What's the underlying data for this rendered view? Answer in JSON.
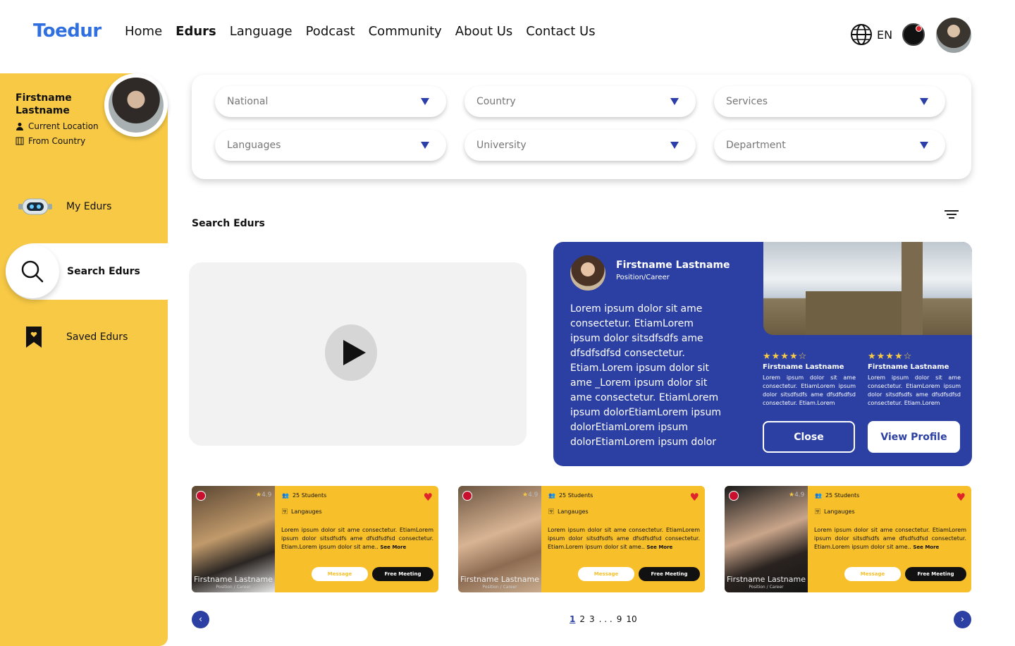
{
  "header": {
    "logo": "Toedur",
    "nav": [
      "Home",
      "Edurs",
      "Language",
      "Podcast",
      "Community",
      "About Us",
      "Contact Us"
    ],
    "active_nav": "Edurs",
    "language": "EN"
  },
  "sidebar": {
    "name": "Firstname Lastname",
    "location": "Current Location",
    "from": "From Country",
    "items": [
      {
        "label": "My Edurs",
        "icon": "robot-icon"
      },
      {
        "label": "Search Edurs",
        "icon": "search-icon",
        "active": true
      },
      {
        "label": "Saved Edurs",
        "icon": "bookmark-icon"
      }
    ]
  },
  "filters": [
    {
      "placeholder": "National"
    },
    {
      "placeholder": "Country"
    },
    {
      "placeholder": "Services"
    },
    {
      "placeholder": "Languages"
    },
    {
      "placeholder": "University"
    },
    {
      "placeholder": "Department"
    }
  ],
  "section_title": "Search Edurs",
  "profile_card": {
    "name": "Firstname Lastname",
    "position": "Position/Career",
    "description": "Lorem ipsum dolor sit ame consectetur. EtiamLorem ipsum dolor sitsdfsdfs ame dfsdfsdfsd consectetur. Etiam.Lorem ipsum dolor sit ame _Lorem ipsum dolor sit ame consectetur. EtiamLorem ipsum dolorEtiamLorem ipsum dolorEtiamLorem ipsum dolorEtiamLorem ipsum dolor",
    "reviews": [
      {
        "stars": "★★★★☆",
        "name": "Firstname Lastname",
        "text": "Lorem ipsum dolor sit ame consectetur. EtiamLorem ipsum dolor sitsdfsdfs ame dfsdfsdfsd consectetur. Etiam.Lorem"
      },
      {
        "stars": "★★★★☆",
        "name": "Firstname Lastname",
        "text": "Lorem ipsum dolor sit ame consectetur. EtiamLorem ipsum dolor sitsdfsdfs ame dfsdfsdfsd consectetur. Etiam.Lorem"
      }
    ],
    "close_label": "Close",
    "view_label": "View Profile"
  },
  "tutors": [
    {
      "rating": "4.9",
      "students": "25 Students",
      "languages": "Langauges",
      "desc": "Lorem ipsum dolor sit ame consectetur. EtiamLorem ipsum dolor sitsdfsdfs ame dfsdfsdfsd consectetur. Etiam.Lorem ipsum dolor sit ame..",
      "see_more": "See More",
      "name": "Firstname Lastname",
      "position": "Position / Career",
      "message": "Message",
      "free": "Free Meeting"
    },
    {
      "rating": "4.9",
      "students": "25 Students",
      "languages": "Langauges",
      "desc": "Lorem ipsum dolor sit ame consectetur. EtiamLorem ipsum dolor sitsdfsdfs ame dfsdfsdfsd consectetur. Etiam.Lorem ipsum dolor sit ame..",
      "see_more": "See More",
      "name": "Firstname Lastname",
      "position": "Position / Career",
      "message": "Message",
      "free": "Free Meeting"
    },
    {
      "rating": "4.9",
      "students": "25 Students",
      "languages": "Langauges",
      "desc": "Lorem ipsum dolor sit ame consectetur. EtiamLorem ipsum dolor sitsdfsdfs ame dfsdfsdfsd consectetur. Etiam.Lorem ipsum dolor sit ame..",
      "see_more": "See More",
      "name": "Firstname Lastname",
      "position": "Position / Career",
      "message": "Message",
      "free": "Free Meeting"
    }
  ],
  "pagination": {
    "pages": [
      "1",
      "2",
      "3",
      ". . .",
      "9",
      "10"
    ],
    "current": "1"
  }
}
